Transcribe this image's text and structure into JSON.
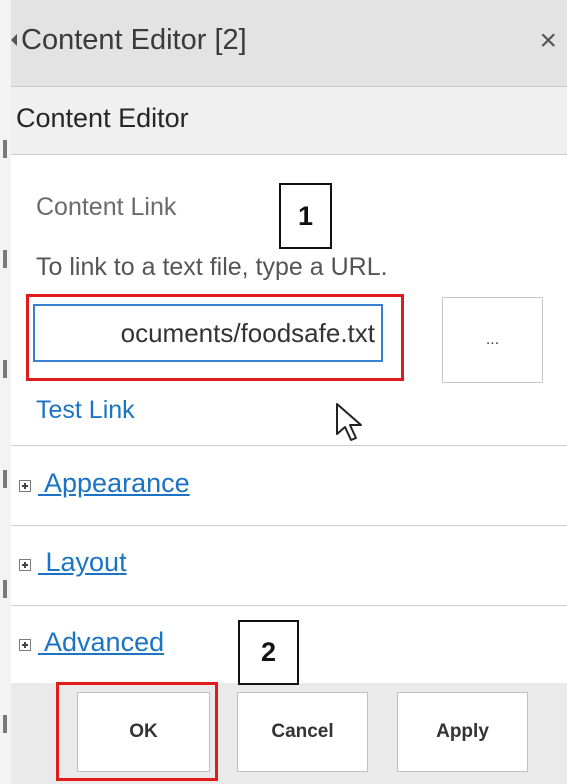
{
  "window": {
    "title": "Content Editor [2]",
    "collapse_icon": "triangle-left-icon",
    "close_label": "×"
  },
  "section": {
    "header": "Content Editor"
  },
  "content_link": {
    "label": "Content Link",
    "description": "To link to a text file, type a URL.",
    "input_value": "ocuments/foodsafe.txt",
    "browse_label": "...",
    "test_link_label": "Test Link"
  },
  "collapsible_sections": [
    {
      "label": " Appearance",
      "icon": "expand-plus-icon"
    },
    {
      "label": " Layout",
      "icon": "expand-plus-icon"
    },
    {
      "label": " Advanced",
      "icon": "expand-plus-icon"
    }
  ],
  "footer": {
    "ok_label": "OK",
    "cancel_label": "Cancel",
    "apply_label": "Apply"
  },
  "annotations": {
    "step1": "1",
    "step2": "2",
    "highlight_color": "#e01b1b"
  },
  "colors": {
    "link": "#1b73c4",
    "input_focus_border": "#3b7fd1",
    "title_bar_bg": "#e3e3e3"
  }
}
